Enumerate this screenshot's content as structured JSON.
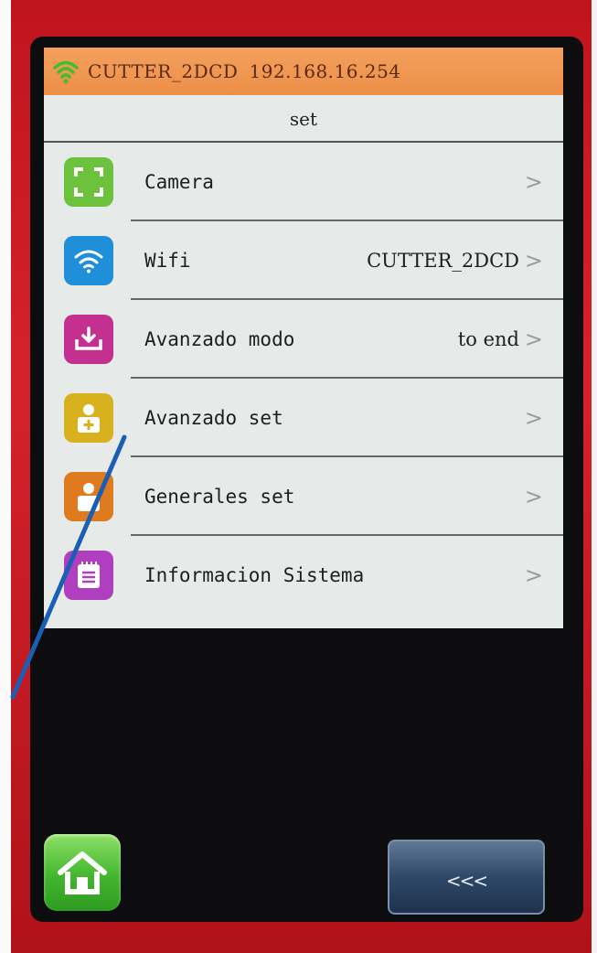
{
  "status_bar": {
    "network_name": "CUTTER_2DCD",
    "ip_address": "192.168.16.254",
    "icon": "wifi-signal-icon",
    "color": "#f0964f"
  },
  "header": {
    "title": "set"
  },
  "menu": {
    "items": [
      {
        "label": "Camera",
        "value": "",
        "chevron": ">",
        "icon": "camera-frame-icon",
        "icon_color": "#6cc23c"
      },
      {
        "label": "Wifi",
        "value": "CUTTER_2DCD",
        "chevron": ">",
        "icon": "wifi-icon",
        "icon_color": "#1e8fd8"
      },
      {
        "label": "Avanzado modo",
        "value": "to end",
        "chevron": ">",
        "icon": "download-tray-icon",
        "icon_color": "#c4308f"
      },
      {
        "label": "Avanzado set",
        "value": "",
        "chevron": ">",
        "icon": "user-plus-icon",
        "icon_color": "#d8b21e"
      },
      {
        "label": "Generales set",
        "value": "",
        "chevron": ">",
        "icon": "user-icon",
        "icon_color": "#e07a1e"
      },
      {
        "label": "Informacion Sistema",
        "value": "",
        "chevron": ">",
        "icon": "notepad-icon",
        "icon_color": "#b03fbf"
      }
    ]
  },
  "footer": {
    "home_icon": "home-icon",
    "back_label": "<<<"
  },
  "annotation": {
    "color": "#1a5fb4"
  }
}
